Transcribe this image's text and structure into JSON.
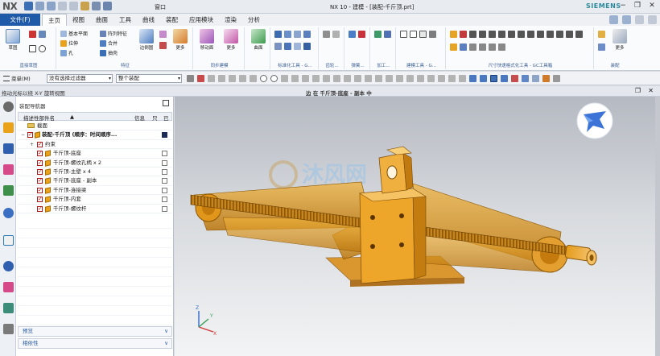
{
  "titlebar": {
    "logo": "NX",
    "window_menu": "窗口",
    "title": "NX 10 - 建模 - [装配-千斤顶.prt]",
    "brand": "SIEMENS"
  },
  "tabs": {
    "file": "文件(F)",
    "items": [
      "主页",
      "视图",
      "曲面",
      "工具",
      "曲线",
      "装配",
      "应用模块",
      "渲染",
      "分析"
    ],
    "active_index": 0
  },
  "ribbon": {
    "sketch_label": "草图",
    "direct_sketch_group": "直接草图",
    "datum_plane": "基本平面",
    "extrude": "拉伸",
    "hole": "孔",
    "pattern_feature": "阵列特征",
    "unite": "合并",
    "shell": "抽壳",
    "edge_blend": "边倒圆",
    "more_1": "更多",
    "feature_group": "特征",
    "move_face": "移动面",
    "more_2": "更多",
    "sync_group": "同步建模",
    "surface": "曲面",
    "standard_tools_group": "标准化工具 - G...",
    "gear_group": "齿轮...",
    "spring_group": "弹簧...",
    "machining_group": "加工...",
    "modeling_tools_group": "建模工具 - G...",
    "dimension_group": "尺寸快速格式化工具 - GC工具箱",
    "assembly_group": "装配",
    "more_3": "更多"
  },
  "selbar": {
    "menu": "菜单(M)",
    "filter": "没有选择过滤器",
    "scope": "整个装配"
  },
  "cue": {
    "left": "拖动光标以绕 X-Y 旋转视图",
    "viewport_title": "边 在 千斤顶-底座 - 副本 中"
  },
  "navigator": {
    "title": "装配导航器",
    "col_name": "描述性部件名",
    "col_info": "信息",
    "col_r": "只",
    "col_d": "已",
    "rows": [
      {
        "label": "截面",
        "level": 0,
        "kind": "folder"
      },
      {
        "label": "装配-千斤顶 (顺序：时间顺序...",
        "level": 0,
        "kind": "assembly"
      },
      {
        "label": "约束",
        "level": 1,
        "kind": "constraints"
      },
      {
        "label": "千斤顶-底座",
        "level": 1,
        "kind": "part"
      },
      {
        "label": "千斤顶-螺纹孔柄 x 2",
        "level": 1,
        "kind": "part"
      },
      {
        "label": "千斤顶-主壁 x 4",
        "level": 1,
        "kind": "part"
      },
      {
        "label": "千斤顶-底座 - 副本",
        "level": 1,
        "kind": "part"
      },
      {
        "label": "千斤顶-连接梁",
        "level": 1,
        "kind": "part"
      },
      {
        "label": "千斤顶-内套",
        "level": 1,
        "kind": "part"
      },
      {
        "label": "千斤顶-螺纹杆",
        "level": 1,
        "kind": "part"
      }
    ],
    "preview": "预览",
    "dependencies": "相依性"
  },
  "watermark": "沐风网",
  "colors": {
    "accent": "#1f5aa8",
    "part": "#e9a21a",
    "checkbox": "#c41a1a"
  }
}
